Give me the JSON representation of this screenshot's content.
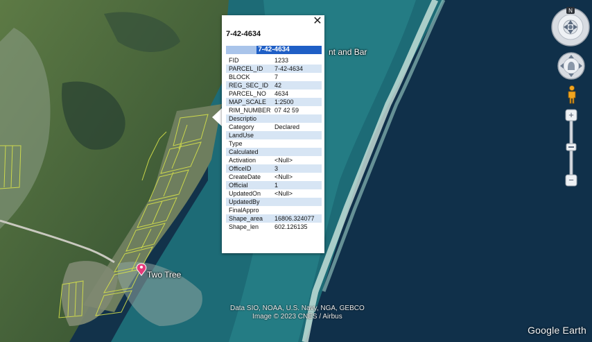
{
  "map": {
    "labels": {
      "place_partial": "nt and Bar",
      "two_tree": "Two Tree"
    },
    "attribution": {
      "line1": "Data SIO, NOAA, U.S. Navy, NGA, GEBCO",
      "line2": "Image © 2023 CNES / Airbus"
    },
    "brand": "Google Earth",
    "colors": {
      "ocean_deep": "#123448",
      "reef_light": "#bfe0d6",
      "lagoon": "#1d6a78",
      "land": "#4f6a3c",
      "parcel_line": "#d7e24a",
      "placemark": "#e6397a"
    }
  },
  "popup": {
    "title": "7-42-4634",
    "header": "7-42-4634",
    "rows": [
      {
        "key": "FID",
        "value": "1233"
      },
      {
        "key": "PARCEL_ID",
        "value": "7-42-4634"
      },
      {
        "key": "BLOCK",
        "value": "7"
      },
      {
        "key": "REG_SEC_ID",
        "value": "42"
      },
      {
        "key": "PARCEL_NO",
        "value": "4634"
      },
      {
        "key": "MAP_SCALE",
        "value": "1:2500"
      },
      {
        "key": "RIM_NUMBER",
        "value": "07 42 59"
      },
      {
        "key": "Descriptio",
        "value": ""
      },
      {
        "key": "Category",
        "value": "Declared"
      },
      {
        "key": "LandUse",
        "value": ""
      },
      {
        "key": "Type",
        "value": ""
      },
      {
        "key": "Calculated",
        "value": ""
      },
      {
        "key": "Activation",
        "value": "<Null>"
      },
      {
        "key": "OfficeID",
        "value": "3"
      },
      {
        "key": "CreateDate",
        "value": "<Null>"
      },
      {
        "key": "Official",
        "value": "1"
      },
      {
        "key": "UpdatedOn",
        "value": "<Null>"
      },
      {
        "key": "UpdatedBy",
        "value": ""
      },
      {
        "key": "FinalAppro",
        "value": ""
      },
      {
        "key": "Shape_area",
        "value": "16806.324077"
      },
      {
        "key": "Shape_len",
        "value": "602.126135"
      }
    ],
    "close_icon": "close-icon"
  },
  "controls": {
    "compass_letter": "N",
    "icons": [
      "compass-icon",
      "look-joystick-icon",
      "pegman-icon",
      "zoom-in-icon",
      "zoom-out-icon"
    ],
    "zoom_in": "+",
    "zoom_out": "−"
  }
}
